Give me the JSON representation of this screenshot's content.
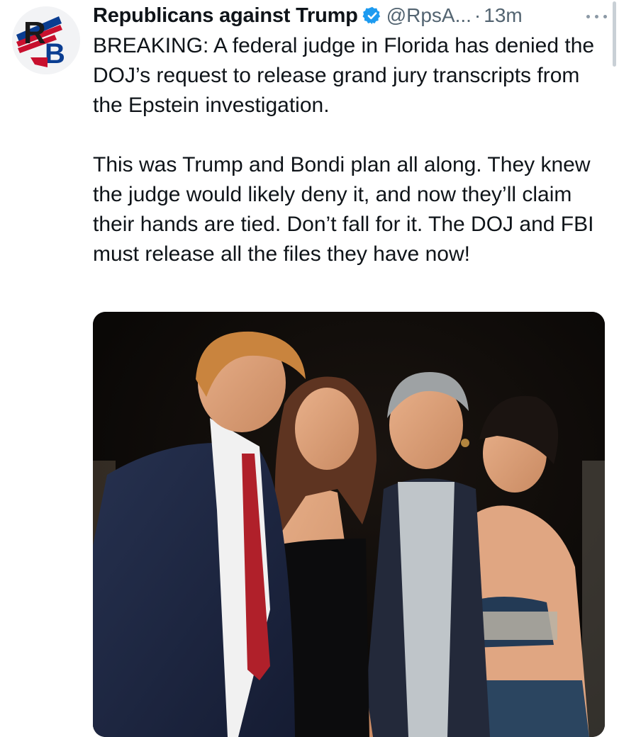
{
  "tweet": {
    "display_name": "Republicans against Trump",
    "handle": "@RpsA...",
    "separator": "·",
    "time": "13m",
    "avatar_letters": "RB",
    "verified_icon": "verified-badge-icon",
    "more_icon": "more-options-icon",
    "text_paragraphs": [
      "BREAKING: A federal judge in Florida has denied the DOJ’s request to release grand jury transcripts from the Epstein investigation.",
      "This was Trump and Bondi plan all along. They knew the judge would likely deny it, and now they’ll claim their hands are tied. Don’t fall for it. The DOJ and FBI must release all the files they have now!"
    ]
  },
  "colors": {
    "text": "#0f1419",
    "secondary": "#536471",
    "verified": "#1d9bf0",
    "avatar_red": "#c8102e",
    "avatar_blue": "#0a3d91"
  }
}
